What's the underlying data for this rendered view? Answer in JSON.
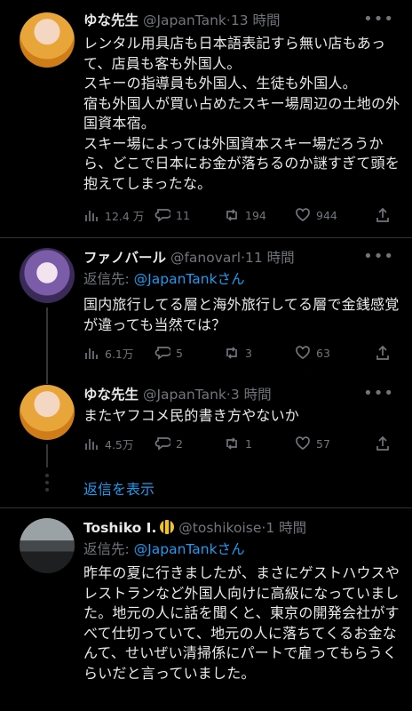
{
  "tweets": [
    {
      "name": "ゆな先生",
      "handle": "@JapanTank",
      "sep": "·",
      "time": "13 時間",
      "text": "レンタル用具店も日本語表記すら無い店もあって、店員も客も外国人。\nスキーの指導員も外国人、生徒も外国人。\n宿も外国人が買い占めたスキー場周辺の土地の外国資本宿。\nスキー場によっては外国資本スキー場だろうから、どこで日本にお金が落ちるのか謎すぎて頭を抱えてしまったな。",
      "views": "12.4 万",
      "replies": "11",
      "retweets": "194",
      "likes": "944"
    },
    {
      "name": "ファノバール",
      "handle": "@fanovarl",
      "sep": "·",
      "time": "11 時間",
      "reply_label": "返信先: ",
      "reply_target": "@JapanTankさん",
      "text": "国内旅行してる層と海外旅行してる層で金銭感覚が違っても当然では？",
      "views": "6.1万",
      "replies": "5",
      "retweets": "3",
      "likes": "63"
    },
    {
      "name": "ゆな先生",
      "handle": "@JapanTank",
      "sep": "·",
      "time": "3 時間",
      "text": "またヤフコメ民的書き方やないか",
      "views": "4.5万",
      "replies": "2",
      "retweets": "1",
      "likes": "57"
    },
    {
      "name": "Toshiko I.",
      "handle": "@toshikoise",
      "sep": "·",
      "time": "1 時間",
      "reply_label": "返信先: ",
      "reply_target": "@JapanTankさん",
      "text": "昨年の夏に行きましたが、まさにゲストハウスやレストランなど外国人向けに高級になっていました。地元の人に話を聞くと、東京の開発会社がすべて仕切っていて、地元の人に落ちてくるお金なんて、せいぜい清掃係にパートで雇ってもらうくらいだと言っていました。"
    }
  ],
  "show_replies": "返信を表示",
  "icons": {
    "views": "bar-chart-icon",
    "reply": "speech-bubble-icon",
    "retweet": "retweet-icon",
    "like": "heart-icon",
    "share": "share-icon",
    "more": "ellipsis-icon",
    "badge": "bee-icon"
  },
  "colors": {
    "background": "#000000",
    "text": "#e7e9ea",
    "muted": "#71767b",
    "link": "#1d9bf0",
    "divider": "#2f3336"
  }
}
